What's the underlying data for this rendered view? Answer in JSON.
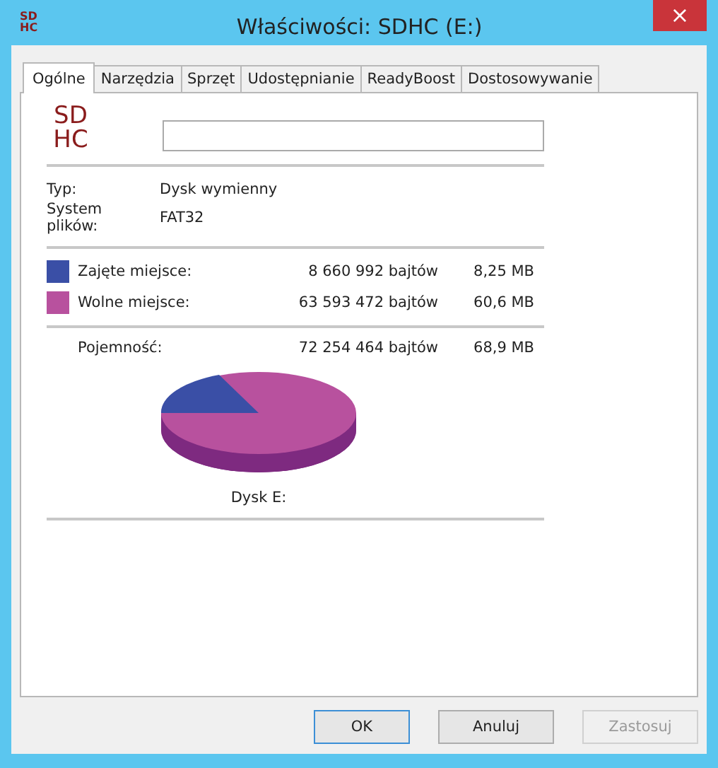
{
  "window": {
    "title": "Właściwości: SDHC (E:)",
    "close": "×"
  },
  "tabs": [
    {
      "label": "Ogólne",
      "selected": true
    },
    {
      "label": "Narzędzia",
      "selected": false
    },
    {
      "label": "Sprzęt",
      "selected": false
    },
    {
      "label": "Udostępnianie",
      "selected": false
    },
    {
      "label": "ReadyBoost",
      "selected": false
    },
    {
      "label": "Dostosowywanie",
      "selected": false
    }
  ],
  "title_icon": {
    "line_1": "SD",
    "line_2": "HC"
  },
  "drive_icon": {
    "line_1": "SD",
    "line_2": "HC"
  },
  "info": [
    {
      "label": "Typ:",
      "value": "Dysk wymienny"
    },
    {
      "label": "System plików:",
      "value": "FAT32"
    }
  ],
  "space": [
    {
      "label": "Zajęte miejsce:",
      "bytes": "8 660 992 bajtów",
      "size": "8,25 MB",
      "color": "#3a4fa6"
    },
    {
      "label": "Wolne miejsce:",
      "bytes": "63 593 472 bajtów",
      "size": "60,6 MB",
      "color": "#b8519e"
    }
  ],
  "capacity": {
    "label": "Pojemność:",
    "bytes": "72 254 464 bajtów",
    "size": "68,9 MB"
  },
  "disk_label": "Dysk E:",
  "buttons": [
    {
      "label": "OK",
      "disabled": false,
      "default": true
    },
    {
      "label": "Anuluj",
      "disabled": false,
      "default": false
    },
    {
      "label": "Zastosuj",
      "disabled": true,
      "default": false
    }
  ]
}
